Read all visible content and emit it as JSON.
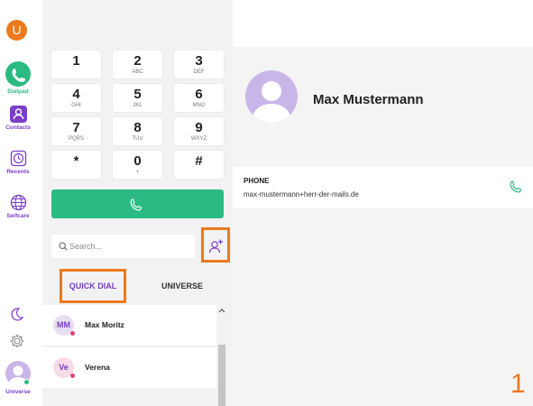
{
  "brand": {
    "logo_letter": "U"
  },
  "nav": {
    "items": [
      {
        "label": "Dialpad",
        "icon": "phone-icon"
      },
      {
        "label": "Contacts",
        "icon": "contacts-icon"
      },
      {
        "label": "Recents",
        "icon": "clock-icon"
      },
      {
        "label": "Selfcare",
        "icon": "globe-icon"
      }
    ],
    "user_label": "Universe"
  },
  "dialpad": {
    "keys": [
      {
        "digit": "1",
        "letters": ""
      },
      {
        "digit": "2",
        "letters": "ABC"
      },
      {
        "digit": "3",
        "letters": "DEF"
      },
      {
        "digit": "4",
        "letters": "GHI"
      },
      {
        "digit": "5",
        "letters": "JKL"
      },
      {
        "digit": "6",
        "letters": "MNO"
      },
      {
        "digit": "7",
        "letters": "PQRS"
      },
      {
        "digit": "8",
        "letters": "TUV"
      },
      {
        "digit": "9",
        "letters": "WXYZ"
      },
      {
        "digit": "*",
        "letters": ""
      },
      {
        "digit": "0",
        "letters": "+"
      },
      {
        "digit": "#",
        "letters": ""
      }
    ]
  },
  "search": {
    "placeholder": "Search..."
  },
  "tabs": {
    "quick_dial": "QUICK DIAL",
    "universe": "UNIVERSE"
  },
  "quick_dial": [
    {
      "initials": "MM",
      "name": "Max Moritz"
    },
    {
      "initials": "Ve",
      "name": "Verena"
    }
  ],
  "contact": {
    "name": "Max Mustermann",
    "phone_label": "PHONE",
    "phone_value": "max-mustermann+herr-der-mails.de"
  },
  "step_marker": "1",
  "colors": {
    "accent_green": "#2bbb82",
    "accent_purple": "#7a3ec7",
    "highlight_orange": "#ec7a1c"
  }
}
